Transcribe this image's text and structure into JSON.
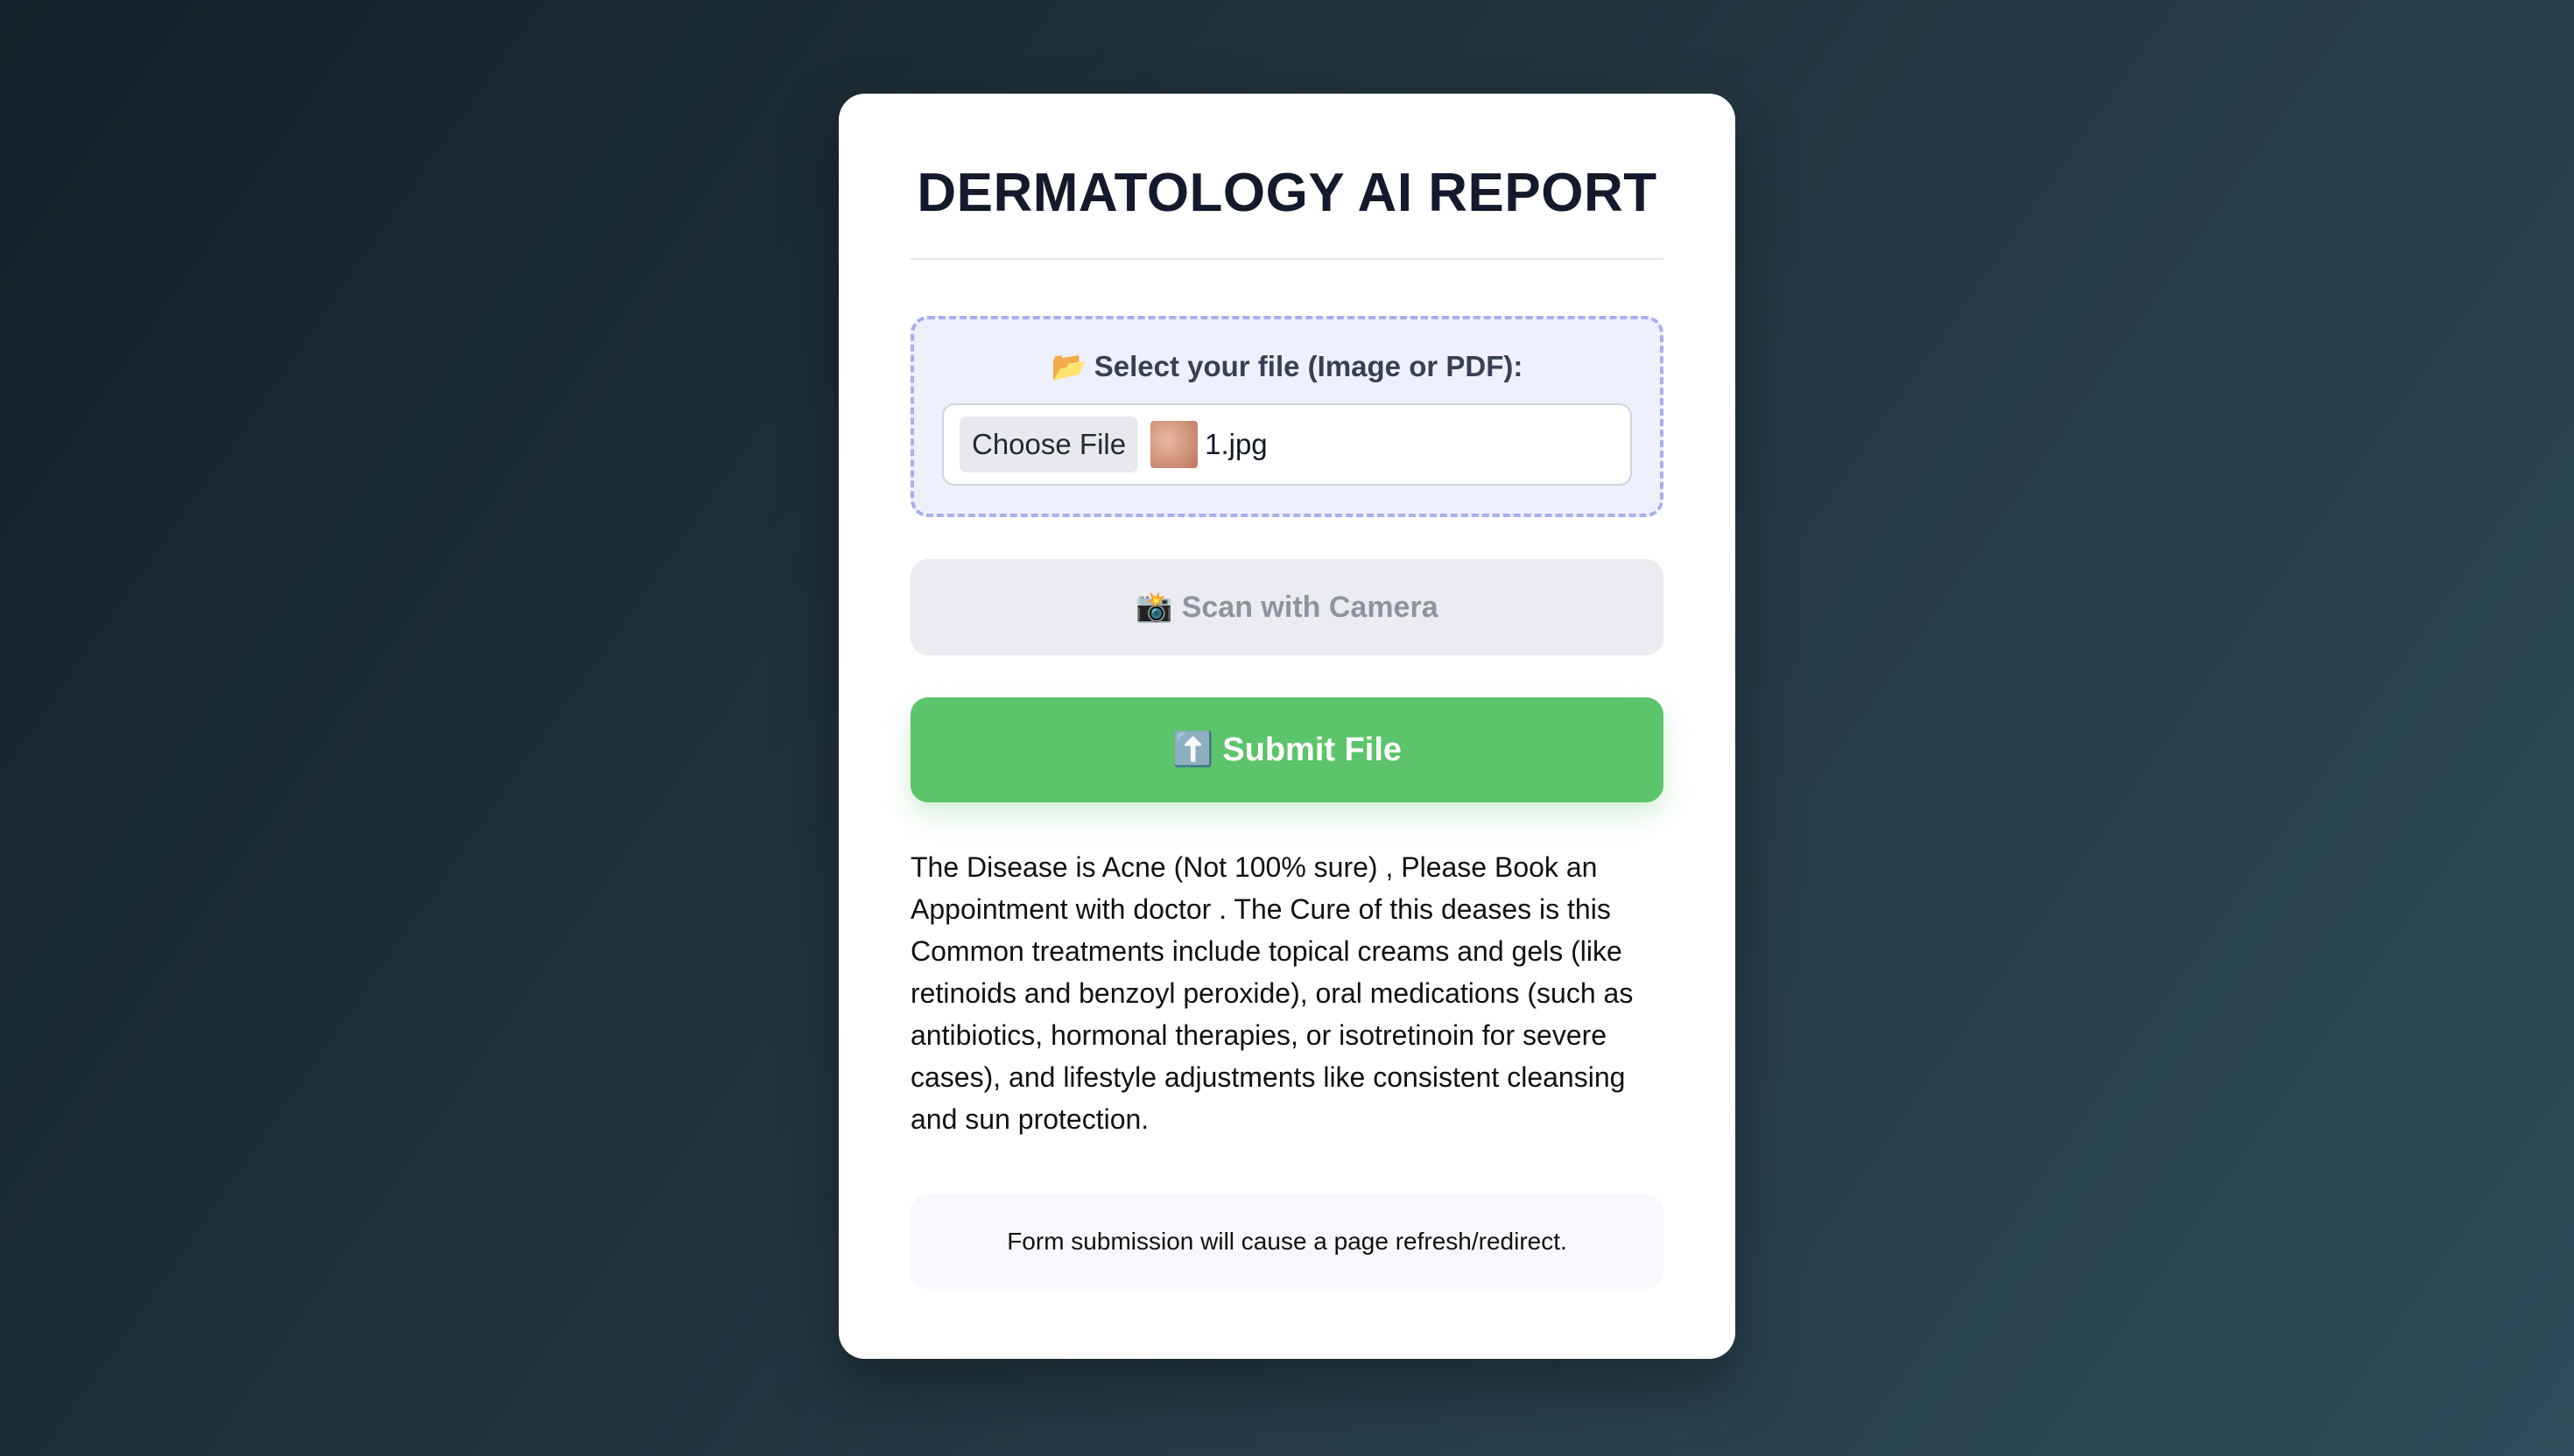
{
  "page": {
    "title": "DERMATOLOGY AI REPORT"
  },
  "upload": {
    "icon": "open-folder-icon",
    "icon_glyph": "📂",
    "label": "Select your file (Image or PDF):",
    "choose_button": "Choose File",
    "file_name": "1.jpg"
  },
  "camera": {
    "icon": "camera-flash-icon",
    "icon_glyph": "📸",
    "label": "Scan with Camera"
  },
  "submit": {
    "icon": "up-arrow-icon",
    "icon_glyph": "⬆️",
    "label": "Submit File"
  },
  "result": {
    "text": "The Disease is Acne (Not 100% sure) , Please Book an Appointment with doctor . The Cure of this deases is this Common treatments include topical creams and gels (like retinoids and benzoyl peroxide), oral medications (such as antibiotics, hormonal therapies, or isotretinoin for severe cases), and lifestyle adjustments like consistent cleansing and sun protection."
  },
  "note": {
    "text": "Form submission will cause a page refresh/redirect."
  },
  "colors": {
    "submit_bg": "#5cc46a",
    "camera_bg": "#ebecf0",
    "upload_bg": "#eef0fd",
    "upload_border": "#a8b0ec",
    "title": "#141a2b"
  }
}
